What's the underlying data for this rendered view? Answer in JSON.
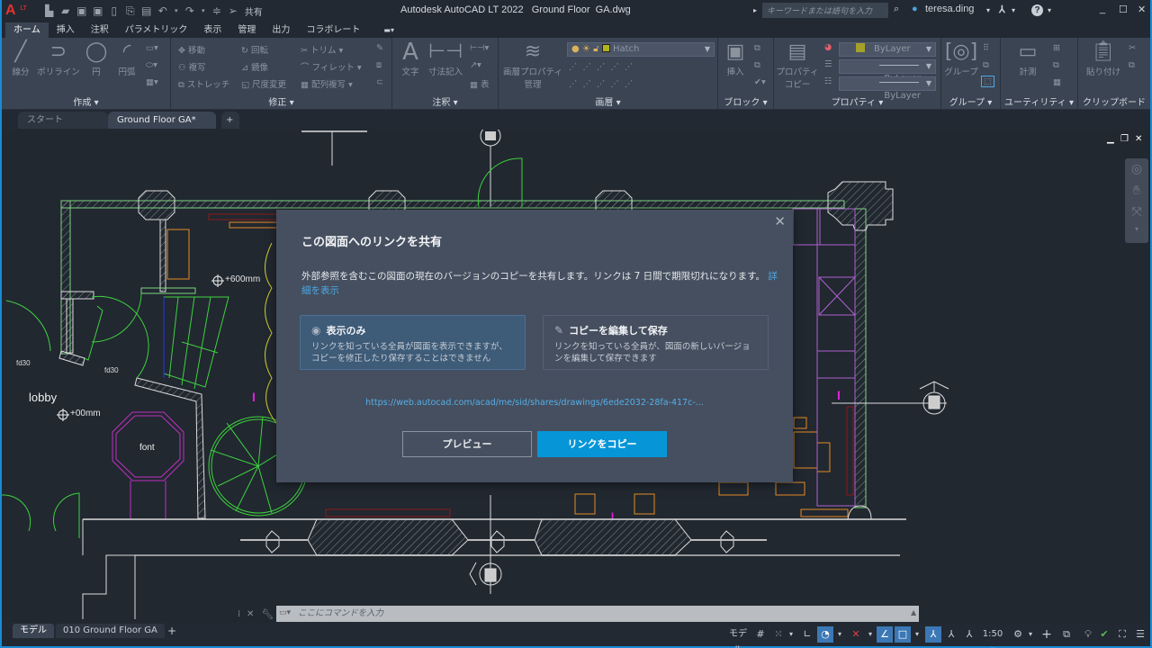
{
  "titlebar": {
    "app_title": "Autodesk AutoCAD LT 2022   Ground Floor  GA.dwg",
    "logo": "A",
    "logo_badge": "LT",
    "share_label": "共有",
    "search_placeholder": "キーワードまたは語句を入力",
    "user": "teresa.ding",
    "help": "?"
  },
  "ribbon_tabs": [
    "ホーム",
    "挿入",
    "注釈",
    "パラメトリック",
    "表示",
    "管理",
    "出力",
    "コラボレート"
  ],
  "ribbon": {
    "draw": {
      "title": "作成 ▾",
      "line": "線分",
      "polyline": "ポリライン",
      "circle": "円",
      "arc": "円弧"
    },
    "modify": {
      "title": "修正 ▾",
      "move": "移動",
      "rotate": "回転",
      "trim": "トリム",
      "copy": "複写",
      "mirror": "鏡像",
      "fillet": "フィレット",
      "stretch": "ストレッチ",
      "scale": "尺度変更",
      "array": "配列複写"
    },
    "annotation": {
      "title": "注釈 ▾",
      "text": "文字",
      "dimension": "寸法記入",
      "table": "表"
    },
    "layers": {
      "title": "画層 ▾",
      "props": "画層プロパティ",
      "props2": "管理",
      "current_layer": "Hatch",
      "layer_color": "#b5b31c"
    },
    "block": {
      "title": "ブロック ▾",
      "insert": "挿入"
    },
    "properties": {
      "title": "プロパティ ▾",
      "match": "プロパティ",
      "match2": "コピー",
      "color": "ByLayer",
      "lineweight": "ByLayer",
      "linetype": "ByLayer",
      "color_swatch": "#a4a12a"
    },
    "groups": {
      "title": "グループ ▾",
      "group": "グループ"
    },
    "utilities": {
      "title": "ユーティリティ ▾",
      "measure": "計測"
    },
    "clipboard": {
      "title": "クリップボード",
      "paste": "貼り付け"
    }
  },
  "doc_tabs": {
    "start": "スタート",
    "active": "Ground Floor  GA*",
    "close": "✕",
    "add": "+"
  },
  "drawing": {
    "labels": {
      "lobby": "lobby",
      "font": "font",
      "fd30_1": "fd30",
      "fd30_2": "fd30",
      "level1": "+600mm",
      "level2": "+00mm"
    }
  },
  "dialog": {
    "title": "この図面へのリンクを共有",
    "description": "外部参照を含むこの図面の現在のバージョンのコピーを共有します。リンクは 7 日間で期限切れになります。",
    "learn_more": "詳細を表示",
    "options": [
      {
        "title": "表示のみ",
        "desc": "リンクを知っている全員が図面を表示できますが、コピーを修正したり保存することはできません",
        "selected": true
      },
      {
        "title": "コピーを編集して保存",
        "desc": "リンクを知っている全員が、図面の新しいバージョンを編集して保存できます",
        "selected": false
      }
    ],
    "url": "https://web.autocad.com/acad/me/sid/shares/drawings/6ede2032-28fa-417c-...",
    "preview_button": "プレビュー",
    "copy_button": "リンクをコピー",
    "close": "✕"
  },
  "command_line": {
    "placeholder": "ここにコマンドを入力"
  },
  "layout_tabs": [
    "モデル",
    "010 Ground Floor GA"
  ],
  "statusbar": {
    "model": "モデル",
    "scale": "1:50"
  },
  "colors": {
    "accent": "#0696d7",
    "selected_option": "#3e5b78",
    "dialog_bg": "#454f5f",
    "canvas": "#212830"
  }
}
